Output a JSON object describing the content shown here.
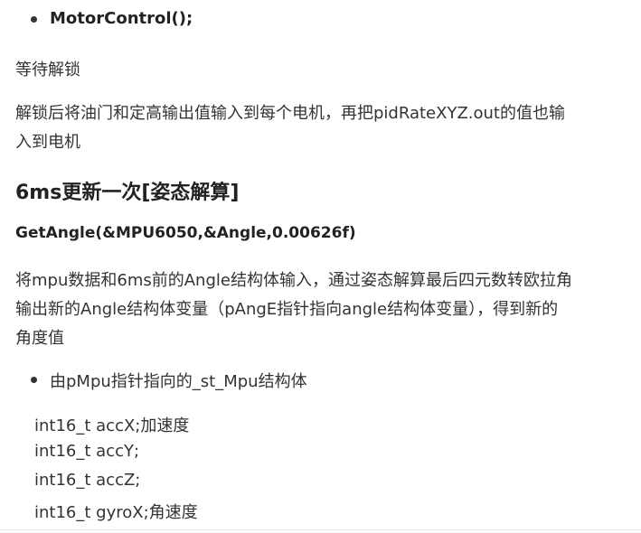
{
  "items": {
    "b1": "MotorControl();",
    "p1": "等待解锁",
    "p2_line1": "解锁后将油门和定高输出值输入到每个电机，再把pidRateXYZ.out的值也输",
    "p2_line2": "入到电机",
    "h1": "6ms更新一次[姿态解算]",
    "h2": "GetAngle(&MPU6050,&Angle,0.00626f)",
    "p3_line1": "将mpu数据和6ms前的Angle结构体输入，通过姿态解算最后四元数转欧拉角",
    "p3_line2": "输出新的Angle结构体变量（pAngE指针指向angle结构体变量），得到新的",
    "p3_line3": "角度值",
    "b2": "由pMpu指针指向的_st_Mpu结构体"
  },
  "code": [
    "int16_t accX;加速度",
    "int16_t accY;",
    "int16_t accZ;",
    "int16_t gyroX;角速度"
  ]
}
